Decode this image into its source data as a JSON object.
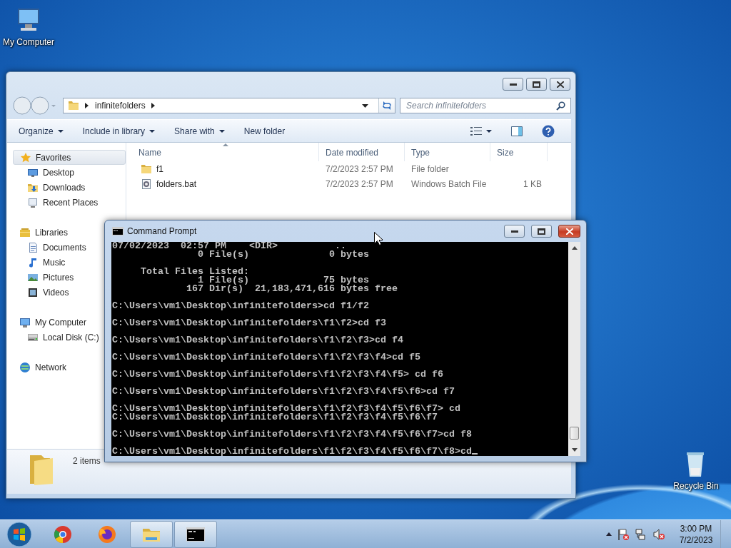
{
  "desktop_icons": [
    {
      "label": "My Computer",
      "kind": "computer"
    },
    {
      "label": "Recycle Bin",
      "kind": "recycle-bin"
    }
  ],
  "explorer": {
    "breadcrumb": [
      "infinitefolders"
    ],
    "search": {
      "placeholder": "Search infinitefolders"
    },
    "toolbar": [
      {
        "label": "Organize",
        "dropdown": true
      },
      {
        "label": "Include in library",
        "dropdown": true
      },
      {
        "label": "Share with",
        "dropdown": true
      },
      {
        "label": "New folder",
        "dropdown": false
      }
    ],
    "nav": [
      {
        "label": "Favorites",
        "kind": "star",
        "selected": true,
        "children": [
          {
            "label": "Desktop",
            "kind": "desktop",
            "selected": false
          },
          {
            "label": "Downloads",
            "kind": "downloads",
            "selected": false
          },
          {
            "label": "Recent Places",
            "kind": "recent",
            "selected": false
          }
        ]
      },
      {
        "label": "Libraries",
        "kind": "library",
        "selected": false,
        "children": [
          {
            "label": "Documents",
            "kind": "documents",
            "selected": false
          },
          {
            "label": "Music",
            "kind": "music",
            "selected": false
          },
          {
            "label": "Pictures",
            "kind": "pictures",
            "selected": false
          },
          {
            "label": "Videos",
            "kind": "videos",
            "selected": false
          }
        ]
      },
      {
        "label": "My Computer",
        "kind": "computer",
        "selected": false,
        "children": [
          {
            "label": "Local Disk (C:)",
            "kind": "disk",
            "selected": false
          }
        ]
      },
      {
        "label": "Network",
        "kind": "network",
        "selected": false
      }
    ],
    "columns": [
      {
        "label": "Name",
        "sorted": true
      },
      {
        "label": "Date modified",
        "sorted": false
      },
      {
        "label": "Type",
        "sorted": false
      },
      {
        "label": "Size",
        "sorted": false
      }
    ],
    "files": [
      {
        "name": "f1",
        "kind": "folder",
        "date": "7/2/2023 2:57 PM",
        "type": "File folder"
      },
      {
        "name": "folders.bat",
        "kind": "batch",
        "date": "7/2/2023 2:57 PM",
        "type": "Windows Batch File",
        "size": "1 KB"
      }
    ],
    "status": "2 items"
  },
  "cmd": {
    "title": "Command Prompt",
    "blocks": [
      [
        "07/02/2023  02:57 PM    <DIR>          ..",
        "               0 File(s)              0 bytes"
      ],
      [
        "     Total Files Listed:",
        "               1 File(s)             75 bytes",
        "             167 Dir(s)  21,183,471,616 bytes free"
      ],
      [
        "C:\\Users\\vm1\\Desktop\\infinitefolders>cd f1/f2"
      ],
      [
        "C:\\Users\\vm1\\Desktop\\infinitefolders\\f1\\f2>cd f3"
      ],
      [
        "C:\\Users\\vm1\\Desktop\\infinitefolders\\f1\\f2\\f3>cd f4"
      ],
      [
        "C:\\Users\\vm1\\Desktop\\infinitefolders\\f1\\f2\\f3\\f4>cd f5"
      ],
      [
        "C:\\Users\\vm1\\Desktop\\infinitefolders\\f1\\f2\\f3\\f4\\f5> cd f6"
      ],
      [
        "C:\\Users\\vm1\\Desktop\\infinitefolders\\f1\\f2\\f3\\f4\\f5\\f6>cd f7"
      ],
      [
        "C:\\Users\\vm1\\Desktop\\infinitefolders\\f1\\f2\\f3\\f4\\f5\\f6\\f7> cd",
        "C:\\Users\\vm1\\Desktop\\infinitefolders\\f1\\f2\\f3\\f4\\f5\\f6\\f7"
      ],
      [
        "C:\\Users\\vm1\\Desktop\\infinitefolders\\f1\\f2\\f3\\f4\\f5\\f6\\f7>cd f8"
      ],
      [
        "C:\\Users\\vm1\\Desktop\\infinitefolders\\f1\\f2\\f3\\f4\\f5\\f6\\f7\\f8>cd"
      ]
    ]
  },
  "taskbar": {
    "apps": [
      {
        "kind": "chrome",
        "running": false
      },
      {
        "kind": "firefox",
        "running": false
      },
      {
        "kind": "explorer",
        "running": true
      },
      {
        "kind": "console",
        "running": true
      }
    ],
    "clock": {
      "time": "3:00 PM",
      "date": "7/2/2023"
    }
  }
}
